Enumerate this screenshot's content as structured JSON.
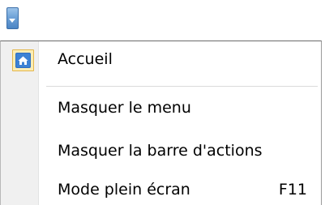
{
  "menu": {
    "items": [
      {
        "label": "Accueil",
        "shortcut": "",
        "icon": "home-icon"
      },
      {
        "label": "Masquer le menu",
        "shortcut": ""
      },
      {
        "label": "Masquer la barre d'actions",
        "shortcut": ""
      },
      {
        "label": "Mode plein écran",
        "shortcut": "F11"
      }
    ]
  },
  "colors": {
    "gutter": "#f0f0f0",
    "icon_highlight_bg": "#fcedb4",
    "icon_highlight_border": "#e3b64a",
    "home_icon_blue": "#2f6fc0",
    "dropdown_button": "#6fa3d8"
  }
}
